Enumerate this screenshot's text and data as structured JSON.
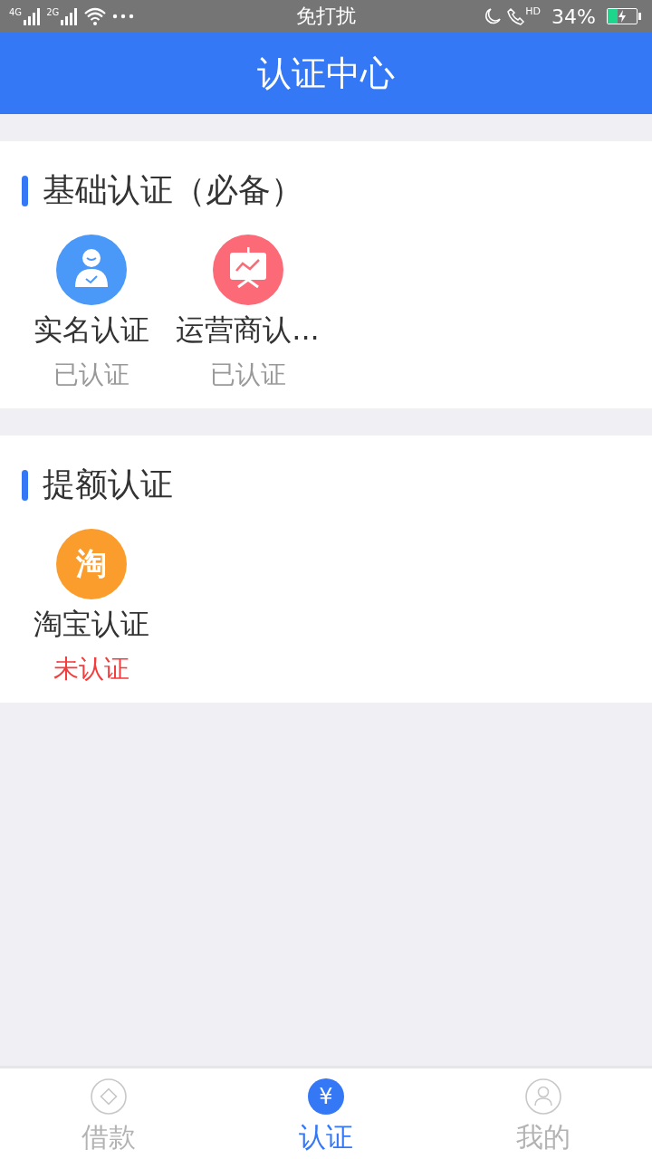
{
  "status_bar": {
    "networks": [
      "4G",
      "2G"
    ],
    "center_text": "免打扰",
    "call_label": "HD",
    "battery_text": "34%",
    "battery": {
      "level": 0.34,
      "charging": true
    }
  },
  "header": {
    "title": "认证中心"
  },
  "sections": [
    {
      "title": "基础认证（必备）",
      "items": [
        {
          "name": "实名认证",
          "status": "已认证",
          "verified": true,
          "icon": {
            "kind": "person",
            "color": "#4a98f7"
          }
        },
        {
          "name": "运营商认...",
          "status": "已认证",
          "verified": true,
          "icon": {
            "kind": "chart",
            "color": "#fb6a76"
          }
        }
      ]
    },
    {
      "title": "提额认证",
      "items": [
        {
          "name": "淘宝认证",
          "status": "未认证",
          "verified": false,
          "icon": {
            "kind": "glyph",
            "glyph": "淘",
            "color": "#fb9d2c"
          }
        }
      ]
    }
  ],
  "tabs": [
    {
      "label": "借款",
      "selected": false,
      "icon": {
        "kind": "diamond"
      }
    },
    {
      "label": "认证",
      "selected": true,
      "icon": {
        "kind": "yen",
        "glyph": "¥"
      }
    },
    {
      "label": "我的",
      "selected": false,
      "icon": {
        "kind": "person"
      }
    }
  ]
}
